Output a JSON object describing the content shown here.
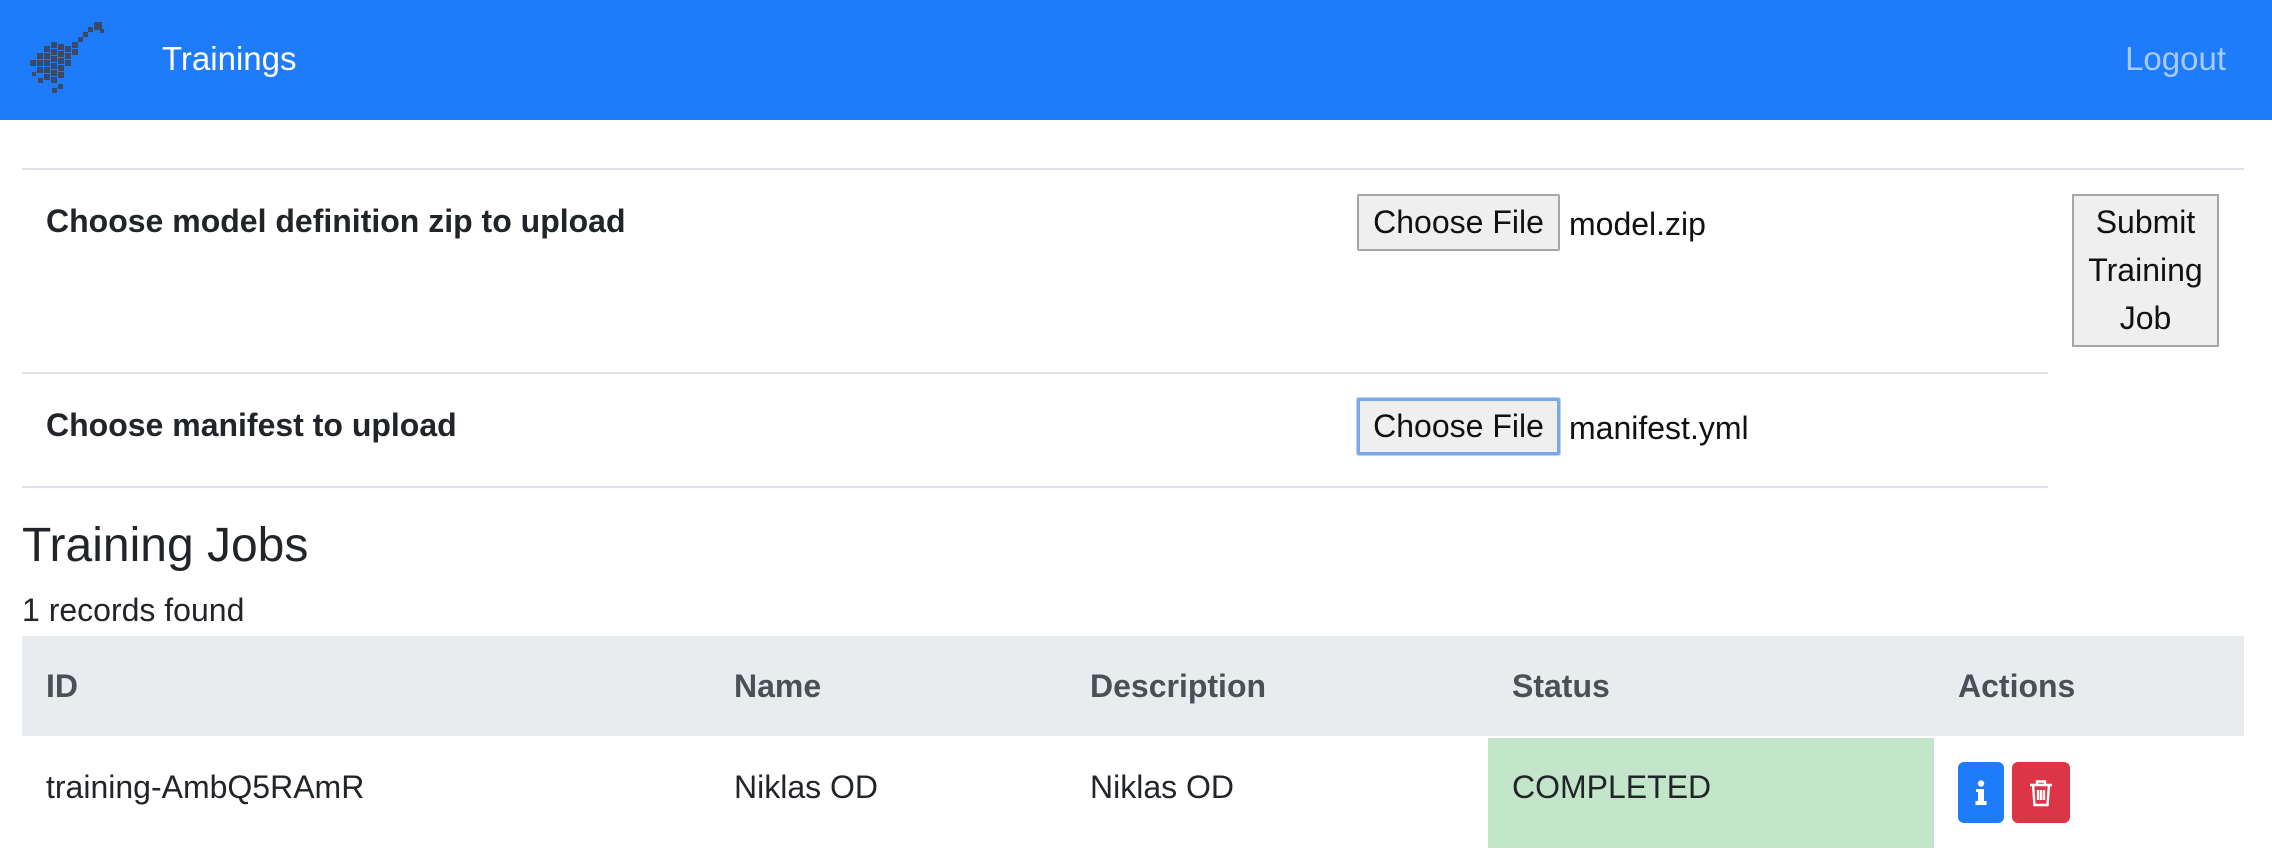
{
  "navbar": {
    "brand": "Trainings",
    "logout_label": "Logout",
    "logo_icon": "guitar-logo-icon",
    "background_color": "#1e7bfa"
  },
  "upload": {
    "model_label": "Choose model definition zip to upload",
    "model_button": "Choose File",
    "model_file": "model.zip",
    "manifest_label": "Choose manifest to upload",
    "manifest_button": "Choose File",
    "manifest_file": "manifest.yml",
    "submit_lines": [
      "Submit",
      "Training",
      "Job"
    ]
  },
  "jobs": {
    "title": "Training Jobs",
    "records_text": "1 records found",
    "columns": [
      "ID",
      "Name",
      "Description",
      "Status",
      "Actions"
    ],
    "rows": [
      {
        "id": "training-AmbQ5RAmR",
        "name": "Niklas OD",
        "description": "Niklas OD",
        "status": "COMPLETED",
        "status_color": "#c3e6cb",
        "actions": [
          "info-icon",
          "trash-icon"
        ]
      }
    ]
  }
}
